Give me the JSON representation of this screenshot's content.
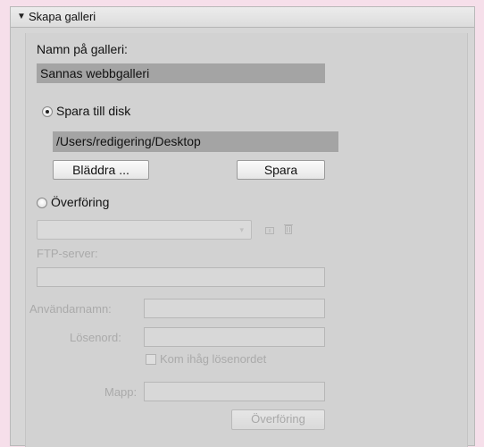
{
  "panel": {
    "title": "Skapa galleri",
    "disclosure_icon": "disclosure-triangle-down"
  },
  "gallery": {
    "name_label": "Namn på galleri:",
    "name_value": "Sannas webbgalleri"
  },
  "save_to_disk": {
    "label": "Spara till disk",
    "selected": true,
    "path_value": "/Users/redigering/Desktop",
    "browse_label": "Bläddra ...",
    "save_label": "Spara"
  },
  "transfer": {
    "label": "Överföring",
    "selected": false,
    "preset_icons": [
      "add-preset-icon",
      "trash-icon"
    ],
    "ftp_label": "FTP-server:",
    "username_label": "Användarnamn:",
    "password_label": "Lösenord:",
    "remember_label": "Kom ihåg lösenordet",
    "folder_label": "Mapp:",
    "transfer_button_label": "Överföring"
  },
  "colors": {
    "panel_bg": "#d6d6d6",
    "field_bg": "#a4a4a4",
    "disabled_text": "#aaaaaa"
  }
}
